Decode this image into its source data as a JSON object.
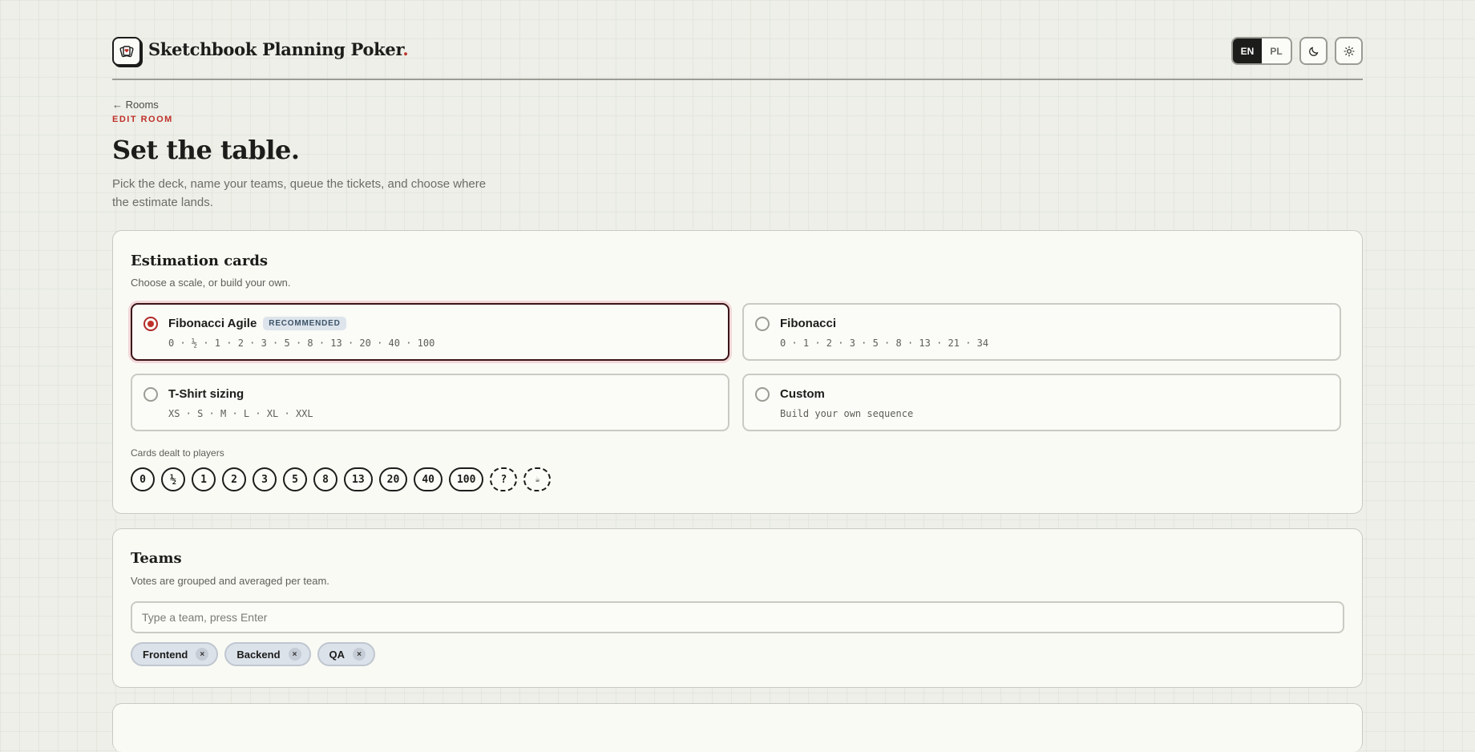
{
  "header": {
    "brand": "Sketchbook Planning Poker",
    "brand_dot": ".",
    "languages": [
      "EN",
      "PL"
    ],
    "active_language": "EN",
    "icons": [
      "logo-cards-icon",
      "moon-icon",
      "sun-icon"
    ]
  },
  "intro": {
    "back_arrow": "←",
    "back_label": "Rooms",
    "eyebrow": "EDIT ROOM",
    "title": "Set the table.",
    "lead": "Pick the deck, name your teams, queue the tickets, and choose where the estimate lands."
  },
  "estimation": {
    "title": "Estimation cards",
    "subtitle": "Choose a scale, or build your own.",
    "options": [
      {
        "name": "Fibonacci Agile",
        "badge": "RECOMMENDED",
        "sequence": "0 · ½ · 1 · 2 · 3 · 5 · 8 · 13 · 20 · 40 · 100",
        "selected": true
      },
      {
        "name": "Fibonacci",
        "sequence": "0 · 1 · 2 · 3 · 5 · 8 · 13 · 21 · 34",
        "selected": false
      },
      {
        "name": "T-Shirt sizing",
        "sequence": "XS · S · M · L · XL · XXL",
        "selected": false
      },
      {
        "name": "Custom",
        "sequence": "Build your own sequence",
        "selected": false
      }
    ],
    "dealt_label": "Cards dealt to players",
    "cards": [
      "0",
      "½",
      "1",
      "2",
      "3",
      "5",
      "8",
      "13",
      "20",
      "40",
      "100"
    ],
    "special_cards": [
      "?",
      "☕"
    ],
    "accent_color": "#c0302a"
  },
  "teams": {
    "title": "Teams",
    "subtitle": "Votes are grouped and averaged per team.",
    "input_placeholder": "Type a team, press Enter",
    "tags": [
      "Frontend",
      "Backend",
      "QA"
    ],
    "remove_glyph": "×"
  }
}
